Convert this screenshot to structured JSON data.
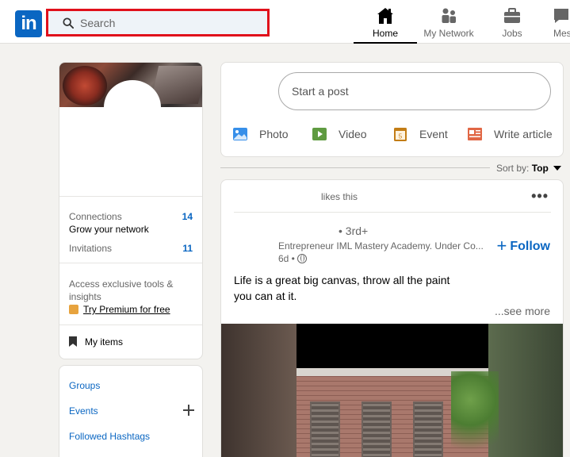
{
  "header": {
    "logo_text": "in",
    "search": {
      "placeholder": "Search",
      "icon": "search-icon"
    },
    "nav": [
      {
        "label": "Home",
        "icon": "home-icon",
        "active": true
      },
      {
        "label": "My Network",
        "icon": "network-icon",
        "active": false
      },
      {
        "label": "Jobs",
        "icon": "briefcase-icon",
        "active": false
      },
      {
        "label": "Mes",
        "icon": "messaging-icon",
        "active": false
      }
    ]
  },
  "profile": {
    "connections_label": "Connections",
    "connections_sub": "Grow your network",
    "connections_count": "14",
    "invitations_label": "Invitations",
    "invitations_count": "11",
    "premium_text": "Access exclusive tools & insights",
    "premium_link": "Try Premium for free",
    "my_items": "My items"
  },
  "side_links": {
    "groups": "Groups",
    "events": "Events",
    "hashtags": "Followed Hashtags"
  },
  "share": {
    "start_post": "Start a post",
    "actions": [
      {
        "label": "Photo",
        "icon": "photo-icon",
        "color": "#378fe9"
      },
      {
        "label": "Video",
        "icon": "video-icon",
        "color": "#5f9b41"
      },
      {
        "label": "Event",
        "icon": "event-icon",
        "color": "#c37d16"
      },
      {
        "label": "Write article",
        "icon": "article-icon",
        "color": "#e16745"
      }
    ]
  },
  "sort": {
    "label": "Sort by:",
    "value": "Top"
  },
  "post": {
    "likes_text": "likes this",
    "more": "•••",
    "degree": "• 3rd+",
    "headline": "Entrepreneur IML Mastery Academy. Under Co...",
    "time": "6d •",
    "follow_label": "Follow",
    "follow_plus": "+",
    "text_line1": "Life is a great big canvas, throw all the paint",
    "text_line2": "you can at it.",
    "see_more": "...see more"
  },
  "colors": {
    "brand": "#0a66c2",
    "search_highlight": "#e0101b",
    "page_bg": "#f3f2ef"
  }
}
